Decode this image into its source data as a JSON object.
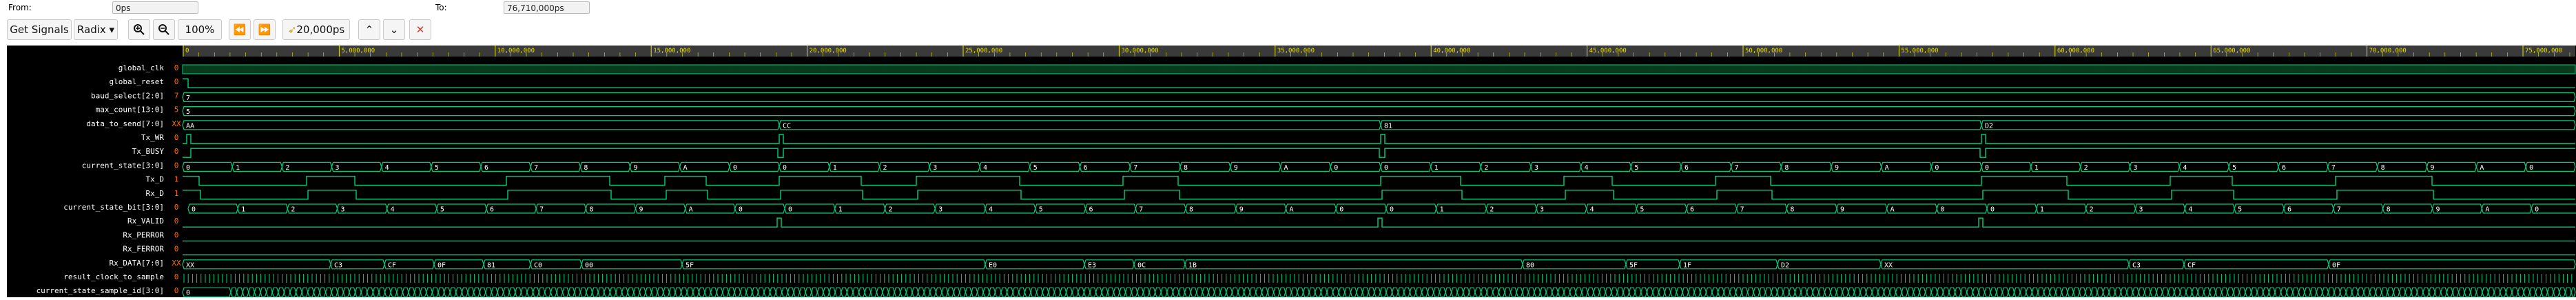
{
  "toolbar": {
    "from_label": "From:",
    "from_value": "0ps",
    "to_label": "To:",
    "to_value": "76,710,000ps",
    "get_signals": "Get Signals",
    "radix": "Radix",
    "zoom_in": "zoom-in-icon",
    "zoom_out": "zoom-out-icon",
    "zoom_level": "100%",
    "prev_edge": "prev-edge-icon",
    "next_edge": "next-edge-icon",
    "cursor_time": "20,000ps",
    "up": "chevron-up-icon",
    "down": "chevron-down-icon",
    "remove": "close-icon",
    "remove_color": "#e03030"
  },
  "ruler": {
    "ticks": [
      "0",
      "5,000,000",
      "10,000,000",
      "15,000,000",
      "20,000,000",
      "25,000,000",
      "30,000,000",
      "35,000,000",
      "40,000,000",
      "45,000,000",
      "50,000,000",
      "55,000,000",
      "60,000,000",
      "65,000,000",
      "70,000,000",
      "75,000,000"
    ]
  },
  "signals": [
    {
      "name": "global_clk",
      "value": "0"
    },
    {
      "name": "global_reset",
      "value": "0"
    },
    {
      "name": "baud_select[2:0]",
      "value": "7"
    },
    {
      "name": "max_count[13:0]",
      "value": "5"
    },
    {
      "name": "data_to_send[7:0]",
      "value": "XX"
    },
    {
      "name": "Tx_WR",
      "value": "0"
    },
    {
      "name": "Tx_BUSY",
      "value": "0"
    },
    {
      "name": "current_state[3:0]",
      "value": "0"
    },
    {
      "name": "Tx_D",
      "value": "1"
    },
    {
      "name": "Rx_D",
      "value": "1"
    },
    {
      "name": "current_state_bit[3:0]",
      "value": "0"
    },
    {
      "name": "Rx_VALID",
      "value": "0"
    },
    {
      "name": "Rx_PERROR",
      "value": "0"
    },
    {
      "name": "Rx_FERROR",
      "value": "0"
    },
    {
      "name": "Rx_DATA[7:0]",
      "value": "XX"
    },
    {
      "name": "result_clock_to_sample",
      "value": "0"
    },
    {
      "name": "current_state_sample_id[3:0]",
      "value": "0"
    }
  ],
  "busLabels": {
    "data_to_send": [
      "AA",
      "CC",
      "81",
      "D2"
    ],
    "current_state": [
      "0",
      "1",
      "2",
      "3",
      "4",
      "5",
      "6",
      "7",
      "8",
      "9",
      "A",
      "0"
    ],
    "rx_data": [
      "XX",
      "C3",
      "CF",
      "0F",
      "81",
      "C0",
      "00",
      "5F",
      "E0",
      "E3",
      "0C",
      "1B",
      "80",
      "5F",
      "1F",
      "D2"
    ],
    "cssid_dash": "0000000000000000"
  },
  "colors": {
    "signal": "#00d07a",
    "bus_text": "#ffffff",
    "ruler_text": "#e8e000",
    "value_text": "#ff6a00",
    "clock_fill": "#0a3a1c"
  }
}
